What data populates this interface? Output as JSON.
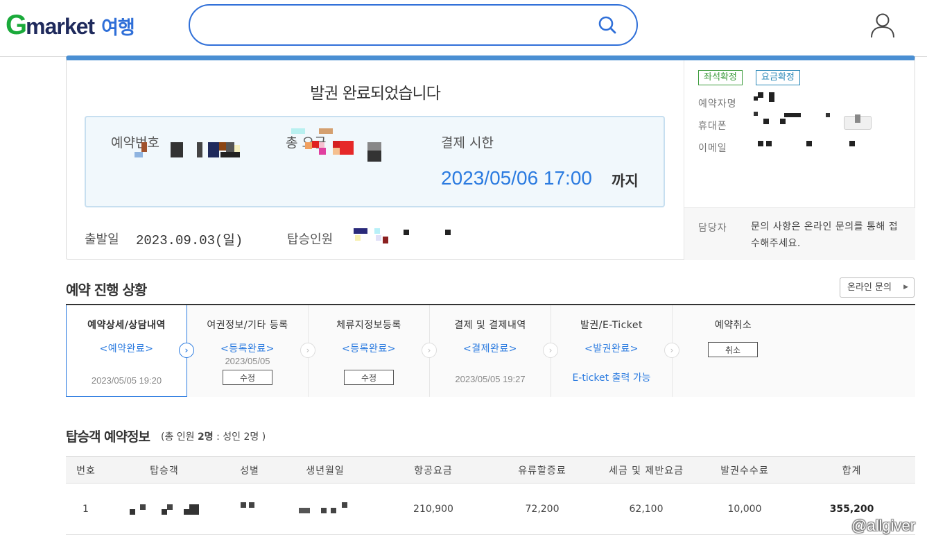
{
  "header": {
    "logo_g": "G",
    "logo_market": "market",
    "logo_travel": "여행",
    "search_placeholder": ""
  },
  "summary": {
    "title": "발권 완료되었습니다",
    "reservation_label": "예약번호",
    "total_fare_label": "총 요금",
    "payment_deadline_label": "결제 시한",
    "payment_deadline": "2023/05/06 17:00",
    "payment_deadline_suffix": "까지",
    "departure_label": "출발일",
    "departure_date": "2023.09.03(일)",
    "passengers_label": "탑승인원",
    "badges": {
      "seat_confirmed": "좌석확정",
      "fare_confirmed": "요금확정"
    },
    "contact": {
      "booker_label": "예약자명",
      "phone_label": "휴대폰",
      "email_label": "이메일",
      "manager_label": "담당자",
      "manager_text": "문의 사항은 온라인 문의를 통해 접수해주세요."
    }
  },
  "progress": {
    "title": "예약 진행 상황",
    "online_inquiry_button": "온라인 문의",
    "steps": [
      {
        "title": "예약상세/상담내역",
        "status": "<예약완료>",
        "date": "2023/05/05 19:20"
      },
      {
        "title": "여권정보/기타 등록",
        "status": "<등록완료>",
        "date": "2023/05/05",
        "button": "수정"
      },
      {
        "title": "체류지정보등록",
        "status": "<등록완료>",
        "button": "수정"
      },
      {
        "title": "결제 및 결제내역",
        "status": "<결제완료>",
        "date": "2023/05/05 19:27"
      },
      {
        "title": "발권/E-Ticket",
        "status": "<발권완료>",
        "link": "E-ticket 출력 가능"
      },
      {
        "title": "예약취소",
        "button": "취소"
      }
    ]
  },
  "passengers": {
    "title": "탑승객 예약정보",
    "subtitle_prefix": "(총 인원",
    "subtitle_total": "2명",
    "subtitle_sep": ":",
    "subtitle_adults": "성인 2명",
    "subtitle_suffix": ")",
    "columns": [
      "번호",
      "탑승객",
      "성별",
      "생년월일",
      "항공요금",
      "유류할증료",
      "세금 및 제반요금",
      "발권수수료",
      "합계"
    ],
    "rows": [
      {
        "no": "1",
        "airfare": "210,900",
        "fuel": "72,200",
        "tax": "62,100",
        "fee": "10,000",
        "total": "355,200"
      }
    ]
  },
  "watermark": "@allgiver",
  "colors": {
    "accent": "#2b7be0",
    "brand_green": "#1aaa3a",
    "brand_navy": "#1f2a5c"
  }
}
